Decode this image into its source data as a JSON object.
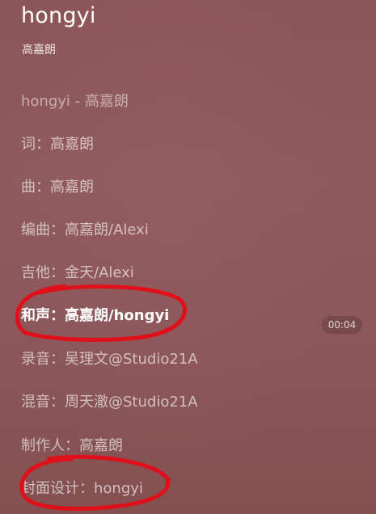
{
  "header": {
    "title": "hongyi",
    "artist": "高嘉朗"
  },
  "lyrics": {
    "lines": [
      "hongyi - 高嘉朗",
      "词：高嘉朗",
      "曲：高嘉朗",
      "编曲：高嘉朗/Alexi",
      "吉他：金天/Alexi",
      "和声：高嘉朗/hongyi",
      "录音：吴理文@Studio21A",
      "混音：周天澈@Studio21A",
      "制作人：高嘉朗",
      "封面设计：hongyi"
    ],
    "active_index": 5
  },
  "player": {
    "time": "00:04"
  },
  "colors": {
    "background": "#8c5558",
    "annotation_red": "#e0101a"
  }
}
